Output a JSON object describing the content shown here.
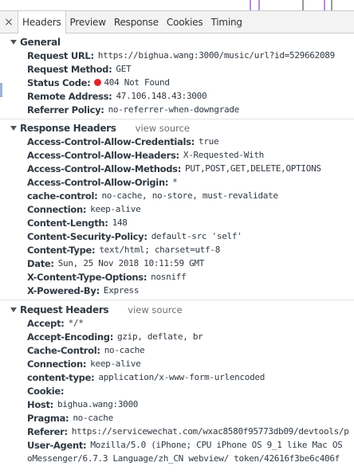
{
  "tabs": [
    {
      "label": "Headers",
      "active": true
    },
    {
      "label": "Preview",
      "active": false
    },
    {
      "label": "Response",
      "active": false
    },
    {
      "label": "Cookies",
      "active": false
    },
    {
      "label": "Timing",
      "active": false
    }
  ],
  "close_glyph": "×",
  "colors": {
    "status_error": "#e0242a",
    "strip_purple": "#b58fd1",
    "strip_gray": "#9a9a9a",
    "selection_marker": "#9ab5d8"
  },
  "general": {
    "title": "General",
    "request_url": {
      "key": "Request URL:",
      "value": "https://bighua.wang:3000/music/url?id=529662089"
    },
    "request_method": {
      "key": "Request Method:",
      "value": "GET"
    },
    "status_code": {
      "key": "Status Code:",
      "value": "404 Not Found",
      "status_icon": "error-dot-icon"
    },
    "remote_address": {
      "key": "Remote Address:",
      "value": "47.106.148.43:3000"
    },
    "referrer_policy": {
      "key": "Referrer Policy:",
      "value": "no-referrer-when-downgrade"
    }
  },
  "response_headers": {
    "title": "Response Headers",
    "view_source": "view source",
    "rows": [
      {
        "key": "Access-Control-Allow-Credentials:",
        "value": "true"
      },
      {
        "key": "Access-Control-Allow-Headers:",
        "value": "X-Requested-With"
      },
      {
        "key": "Access-Control-Allow-Methods:",
        "value": "PUT,POST,GET,DELETE,OPTIONS"
      },
      {
        "key": "Access-Control-Allow-Origin:",
        "value": "*"
      },
      {
        "key": "cache-control:",
        "value": "no-cache, no-store, must-revalidate"
      },
      {
        "key": "Connection:",
        "value": "keep-alive"
      },
      {
        "key": "Content-Length:",
        "value": "148"
      },
      {
        "key": "Content-Security-Policy:",
        "value": "default-src 'self'"
      },
      {
        "key": "Content-Type:",
        "value": "text/html; charset=utf-8"
      },
      {
        "key": "Date:",
        "value": "Sun, 25 Nov 2018 10:11:59 GMT"
      },
      {
        "key": "X-Content-Type-Options:",
        "value": "nosniff"
      },
      {
        "key": "X-Powered-By:",
        "value": "Express"
      }
    ]
  },
  "request_headers": {
    "title": "Request Headers",
    "view_source": "view source",
    "rows": [
      {
        "key": "Accept:",
        "value": "*/*"
      },
      {
        "key": "Accept-Encoding:",
        "value": "gzip, deflate, br"
      },
      {
        "key": "Cache-Control:",
        "value": "no-cache"
      },
      {
        "key": "Connection:",
        "value": "keep-alive"
      },
      {
        "key": "content-type:",
        "value": "application/x-www-form-urlencoded"
      },
      {
        "key": "Cookie:",
        "value": ""
      },
      {
        "key": "Host:",
        "value": "bighua.wang:3000"
      },
      {
        "key": "Pragma:",
        "value": "no-cache"
      },
      {
        "key": "Referer:",
        "value": "https://servicewechat.com/wxac8580f95773db09/devtools/p"
      },
      {
        "key": "User-Agent:",
        "value": "Mozilla/5.0 (iPhone; CPU iPhone OS 9_1 like Mac OS"
      }
    ],
    "user_agent_continuation": "oMessenger/6.7.3 Language/zh_CN webview/ token/42616f3be6c406f"
  }
}
